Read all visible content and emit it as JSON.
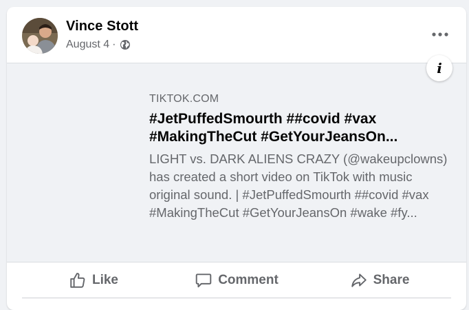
{
  "post": {
    "author": "Vince Stott",
    "date": "August 4",
    "separator": "·",
    "audience_icon": "globe-icon",
    "more_icon": "more-horizontal-icon"
  },
  "link_preview": {
    "domain": "TIKTOK.COM",
    "title": "#JetPuffedSmourth ##covid #vax #MakingTheCut #GetYourJeansOn...",
    "description": "LIGHT vs. DARK ALIENS CRAZY (@wakeupclowns) has created a short video on TikTok with music original sound. | #JetPuffedSmourth ##covid #vax #MakingTheCut #GetYourJeansOn #wake #fy...",
    "info_icon": "info-icon"
  },
  "actions": {
    "like": "Like",
    "comment": "Comment",
    "share": "Share"
  },
  "colors": {
    "text_primary": "#050505",
    "text_secondary": "#65676b",
    "preview_bg": "#f0f2f5",
    "divider": "#ced0d4"
  }
}
